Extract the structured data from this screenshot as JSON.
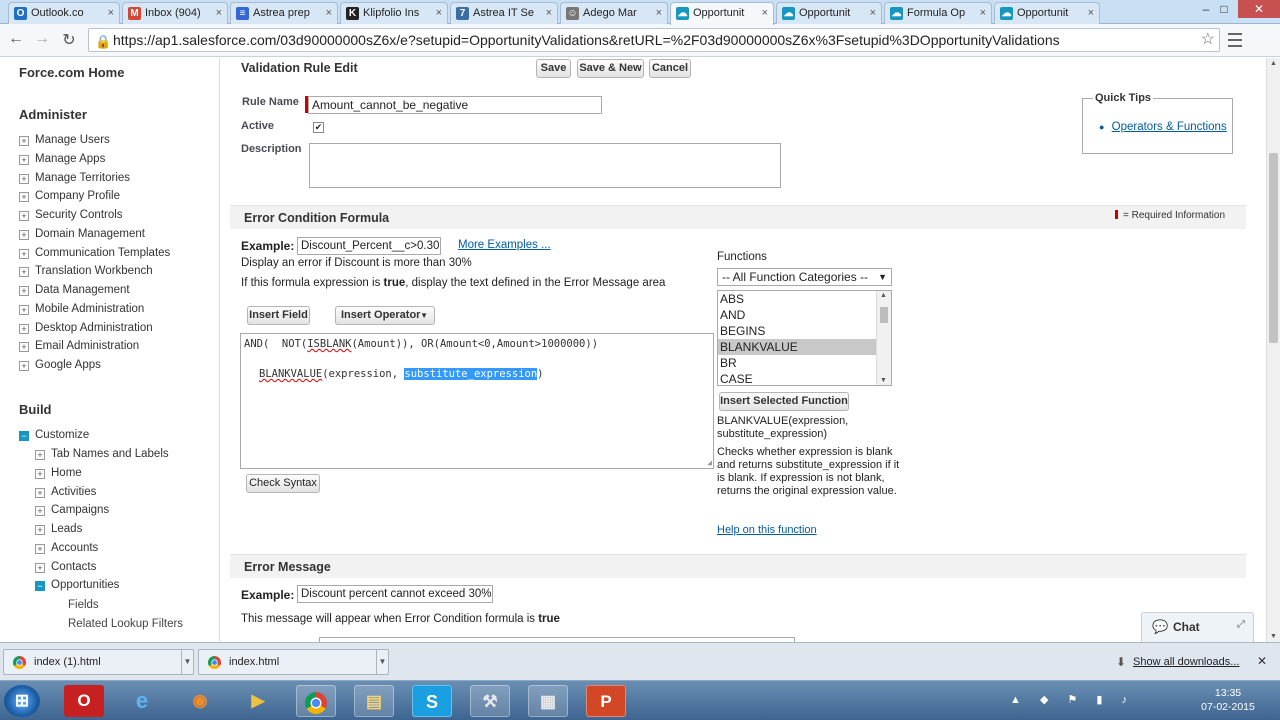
{
  "browser": {
    "tabs": [
      {
        "title": "Outlook.co",
        "fav": "O",
        "color": "#1f6fc5"
      },
      {
        "title": "Inbox (904)",
        "fav": "M",
        "color": "#d14836"
      },
      {
        "title": "Astrea prep",
        "fav": "≡",
        "color": "#3367d6"
      },
      {
        "title": "Klipfolio Ins",
        "fav": "K",
        "color": "#222222"
      },
      {
        "title": "Astrea IT Se",
        "fav": "7",
        "color": "#3a6ea5"
      },
      {
        "title": "Adego Mar",
        "fav": "☺",
        "color": "#777777"
      },
      {
        "title": "Opportunit",
        "fav": "☁",
        "color": "#1797c0"
      },
      {
        "title": "Opportunit",
        "fav": "☁",
        "color": "#1797c0"
      },
      {
        "title": "Formula Op",
        "fav": "☁",
        "color": "#1797c0"
      },
      {
        "title": "Opportunit",
        "fav": "☁",
        "color": "#1797c0"
      }
    ],
    "url": "https://ap1.salesforce.com/03d90000000sZ6x/e?setupid=OpportunityValidations&retURL=%2F03d90000000sZ6x%3Fsetupid%3DOpportunityValidations"
  },
  "sidebar": {
    "home": "Force.com Home",
    "administer_title": "Administer",
    "administer_items": [
      "Manage Users",
      "Manage Apps",
      "Manage Territories",
      "Company Profile",
      "Security Controls",
      "Domain Management",
      "Communication Templates",
      "Translation Workbench",
      "Data Management",
      "Mobile Administration",
      "Desktop Administration",
      "Email Administration",
      "Google Apps"
    ],
    "build_title": "Build",
    "customize": "Customize",
    "customize_items": [
      "Tab Names and Labels",
      "Home",
      "Activities",
      "Campaigns",
      "Leads",
      "Accounts",
      "Contacts",
      "Opportunities"
    ],
    "opportunity_items": [
      "Fields",
      "Related Lookup Filters"
    ]
  },
  "page": {
    "title": "Validation Rule Edit",
    "save": "Save",
    "save_new": "Save & New",
    "cancel": "Cancel",
    "rule_name_label": "Rule Name",
    "rule_name_value": "Amount_cannot_be_negative",
    "active_label": "Active",
    "active_checked": "✔",
    "description_label": "Description",
    "quick_tips_title": "Quick Tips",
    "quick_tips_link": "Operators & Functions",
    "error_condition_title": "Error Condition Formula",
    "required_info": "= Required Information",
    "example_label": "Example:",
    "example_value": "Discount_Percent__c>0.30",
    "more_examples": "More Examples ...",
    "example_desc": "Display an error if Discount is more than 30%",
    "expr_desc_pre": "If this formula expression is ",
    "expr_desc_bold": "true",
    "expr_desc_post": ", display the text defined in the Error Message area",
    "insert_field": "Insert Field",
    "insert_operator": "Insert Operator",
    "formula_line1": {
      "a": "AND(  NOT(",
      "b": "ISBLANK",
      "c": "(Amount)), OR(Amount<0,Amount>1000000))"
    },
    "formula_line2": {
      "a": "BLANKVALUE",
      "b": "(expression, ",
      "c": "substitute_expression",
      "d": ")"
    },
    "check_syntax": "Check Syntax",
    "functions_label": "Functions",
    "functions_category": "-- All Function Categories --",
    "functions": [
      "ABS",
      "AND",
      "BEGINS",
      "BLANKVALUE",
      "BR",
      "CASE"
    ],
    "selected_function": "BLANKVALUE",
    "insert_selected_function": "Insert Selected Function",
    "function_signature": "BLANKVALUE(expression, substitute_expression)",
    "function_help": "Checks whether expression is blank and returns substitute_expression if it is blank. If expression is not blank, returns the original expression value.",
    "help_link": "Help on this function",
    "error_message_title": "Error Message",
    "em_example_label": "Example:",
    "em_example_value": "Discount percent cannot exceed 30%",
    "em_desc_pre": "This message will appear when Error Condition formula is ",
    "em_desc_bold": "true"
  },
  "chat": {
    "label": "Chat"
  },
  "downloads": {
    "items": [
      "index (1).html",
      "index.html"
    ],
    "show_all": "Show all downloads..."
  },
  "taskbar": {
    "time": "13:35",
    "date": "07-02-2015"
  }
}
